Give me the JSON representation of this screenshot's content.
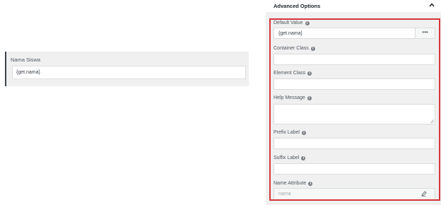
{
  "preview": {
    "label": "Nama Siswa",
    "value": "{get.nama}"
  },
  "panel": {
    "title": "Advanced Options",
    "default_value": {
      "label": "Default Value",
      "value": "{get.nama}",
      "button": "•••"
    },
    "container_class": {
      "label": "Container Class",
      "value": ""
    },
    "element_class": {
      "label": "Element Class",
      "value": ""
    },
    "help_message": {
      "label": "Help Message",
      "value": ""
    },
    "prefix_label": {
      "label": "Prefix Label",
      "value": ""
    },
    "suffix_label": {
      "label": "Suffix Label",
      "value": ""
    },
    "name_attribute": {
      "label": "Name Attribute",
      "placeholder": "nama"
    }
  },
  "colors": {
    "highlight": "#d63638",
    "panel_bg": "#f0f0f1"
  }
}
